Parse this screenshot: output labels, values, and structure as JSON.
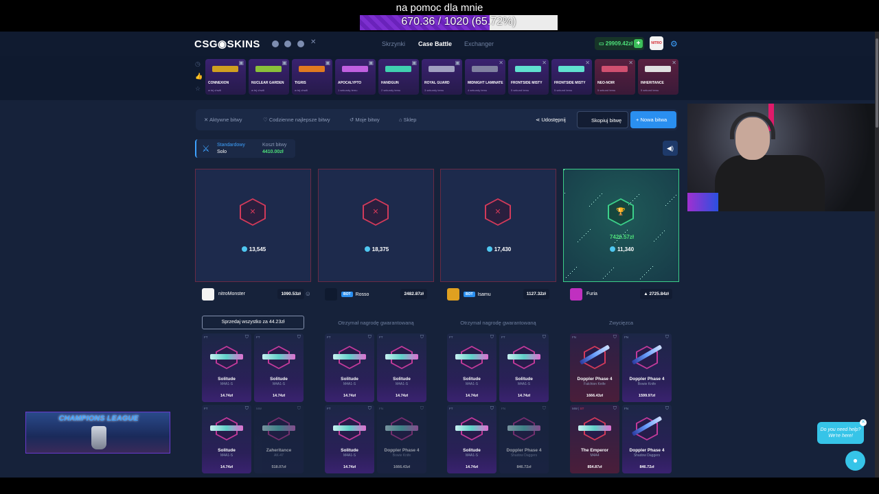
{
  "donation": {
    "title": "na pomoc dla mnie",
    "progress_text": "670.36 / 1020 (65.72%)",
    "progress": 0.6572
  },
  "header": {
    "logo": "CSG◉SKINS",
    "nav": [
      {
        "label": "Skrzynki"
      },
      {
        "label": "Case Battle"
      },
      {
        "label": "Exchanger"
      }
    ],
    "balance": "29909.42zł",
    "avatar_text": "NITRO"
  },
  "cases": [
    {
      "name": "CONNEXION",
      "sub": "w tej chwili",
      "color": "#d0a020"
    },
    {
      "name": "NUCLEAR GARDEN",
      "sub": "w tej chwili",
      "color": "#8ac03a"
    },
    {
      "name": "TIGRIS",
      "sub": "w tej chwili",
      "color": "#e07a20"
    },
    {
      "name": "APOCALYPTO",
      "sub": "1 sekundę temu",
      "color": "#c060e0"
    },
    {
      "name": "HANDGUN",
      "sub": "2 sekundy temu",
      "color": "#40d0b0"
    },
    {
      "name": "ROYAL GUARD",
      "sub": "3 sekundy temu",
      "color": "#a0a0c0"
    },
    {
      "name": "MIDNIGHT LAMINATE",
      "sub": "4 sekundy temu",
      "color": "#8080a0"
    },
    {
      "name": "FRONTSIDE MISTY",
      "sub": "5 sekund temu",
      "color": "#60e0d0"
    },
    {
      "name": "FRONTSIDE MISTY",
      "sub": "5 sekund temu",
      "color": "#60e0d0"
    },
    {
      "name": "NEO-NOIR",
      "sub": "5 sekund temu",
      "color": "#d05070"
    },
    {
      "name": "INHERITANCE",
      "sub": "5 sekund temu",
      "color": "#e0e0e0"
    }
  ],
  "tabs": [
    {
      "label": "Aktywne bitwy"
    },
    {
      "label": "Codzienne najlepsze bitwy"
    },
    {
      "label": "Moje bitwy"
    },
    {
      "label": "Sklep"
    }
  ],
  "actions": {
    "share": "Udostępnij",
    "copy": "Skopiuj bitwę",
    "new": "+ Nowa bitwa"
  },
  "mode": {
    "type": "Standardowy",
    "sub": "Solo",
    "cost_label": "Koszt bitwy",
    "cost": "4410.00zł"
  },
  "players": [
    {
      "coins": "13,545",
      "name": "nitroMonster",
      "bot": false,
      "amount": "1090.53zł",
      "label": "Sprzedaj wszystko za 44.23zł"
    },
    {
      "coins": "18,375",
      "name": "Rosso",
      "bot": true,
      "bot_label": "BOT",
      "amount": "2482.87zł",
      "label": "Otrzymał nagrodę gwarantowaną"
    },
    {
      "coins": "17,430",
      "name": "Isamu",
      "bot": true,
      "bot_label": "BOT",
      "amount": "1127.32zł",
      "label": "Otrzymał nagrodę gwarantowaną"
    },
    {
      "coins": "11,340",
      "name": "Furia",
      "bot": false,
      "amount": "2725.84zł",
      "label": "Zwycięzca",
      "win_value": "7426.57zł"
    }
  ],
  "items": [
    [
      {
        "cond": "FT",
        "name": "Solitude",
        "sub": "M4A1-S",
        "price": "14.74zł"
      },
      {
        "cond": "FT",
        "name": "Solitude",
        "sub": "M4A1-S",
        "price": "14.74zł"
      },
      {
        "cond": "FT",
        "name": "Solitude",
        "sub": "M4A1-S",
        "price": "14.74zł"
      },
      {
        "cond": "MW",
        "name": "Zaheritance",
        "sub": "AK-47",
        "price": "518.07zł",
        "dim": true
      }
    ],
    [
      {
        "cond": "FT",
        "name": "Solitude",
        "sub": "M4A1-S",
        "price": "14.74zł"
      },
      {
        "cond": "FT",
        "name": "Solitude",
        "sub": "M4A1-S",
        "price": "14.74zł"
      },
      {
        "cond": "FT",
        "name": "Solitude",
        "sub": "M4A1-S",
        "price": "14.74zł"
      },
      {
        "cond": "FN",
        "name": "Doppler Phase 4",
        "sub": "Bowie Knife",
        "price": "1666.43zł",
        "dim": true
      }
    ],
    [
      {
        "cond": "FT",
        "name": "Solitude",
        "sub": "M4A1-S",
        "price": "14.74zł"
      },
      {
        "cond": "FT",
        "name": "Solitude",
        "sub": "M4A1-S",
        "price": "14.74zł"
      },
      {
        "cond": "FT",
        "name": "Solitude",
        "sub": "M4A1-S",
        "price": "14.74zł"
      },
      {
        "cond": "FN",
        "name": "Doppler Phase 4",
        "sub": "Shadow Daggers",
        "price": "846.72zł",
        "dim": true
      }
    ],
    [
      {
        "cond": "FN",
        "name": "Doppler Phase 4",
        "sub": "Falchion Knife",
        "price": "1666.43zł",
        "red": true,
        "knife": true
      },
      {
        "cond": "FN",
        "name": "Doppler Phase 4",
        "sub": "Bowie Knife",
        "price": "1599.97zł",
        "knife": true
      },
      {
        "cond": "MW",
        "cond2": "ST",
        "name": "The Emperor",
        "sub": "M4A4",
        "price": "854.87zł",
        "red": true
      },
      {
        "cond": "FN",
        "name": "Doppler Phase 4",
        "sub": "Shadow Daggers",
        "price": "846.72zł",
        "knife": true
      }
    ]
  ],
  "banner": {
    "title": "CHAMPIONS LEAGUE"
  },
  "help": {
    "text": "Do you need help? We're here!"
  }
}
